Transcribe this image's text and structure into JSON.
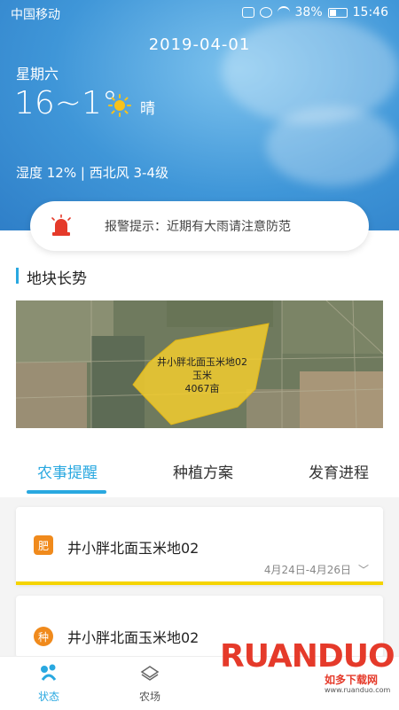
{
  "status_bar": {
    "carrier": "中国移动",
    "battery": "38%",
    "time": "15:46"
  },
  "weather": {
    "date": "2019-04-01",
    "weekday": "星期六",
    "temp_range": "16~1°",
    "condition": "晴",
    "condition_icon": "sun-icon",
    "humidity_wind": "湿度 12% | 西北风 3-4级"
  },
  "alert": {
    "icon": "siren-icon",
    "text": "报警提示：近期有大雨请注意防范"
  },
  "section": {
    "title": "地块长势"
  },
  "map": {
    "field_name": "井小胖北面玉米地02",
    "crop": "玉米",
    "area": "4067亩"
  },
  "tabs": [
    {
      "label": "农事提醒",
      "active": true
    },
    {
      "label": "种植方案",
      "active": false
    },
    {
      "label": "发育进程",
      "active": false
    }
  ],
  "reminders": [
    {
      "icon_char": "肥",
      "icon": "fertilizer-icon",
      "title": "井小胖北面玉米地02",
      "date_range": "4月24日-4月26日"
    },
    {
      "icon_char": "种",
      "icon": "seed-icon",
      "title": "井小胖北面玉米地02"
    }
  ],
  "bottom_nav": [
    {
      "label": "状态",
      "icon": "status-icon",
      "active": true
    },
    {
      "label": "农场",
      "icon": "farm-icon",
      "active": false
    }
  ],
  "watermark": {
    "brand": "RUANDUO",
    "cn": "如多下载网",
    "url": "www.ruanduo.com"
  },
  "colors": {
    "accent": "#29a8e0",
    "sky": "#3f96d8",
    "highlight": "#f5d400",
    "alert_red": "#e53a2a",
    "fertilizer": "#f08a1c"
  }
}
